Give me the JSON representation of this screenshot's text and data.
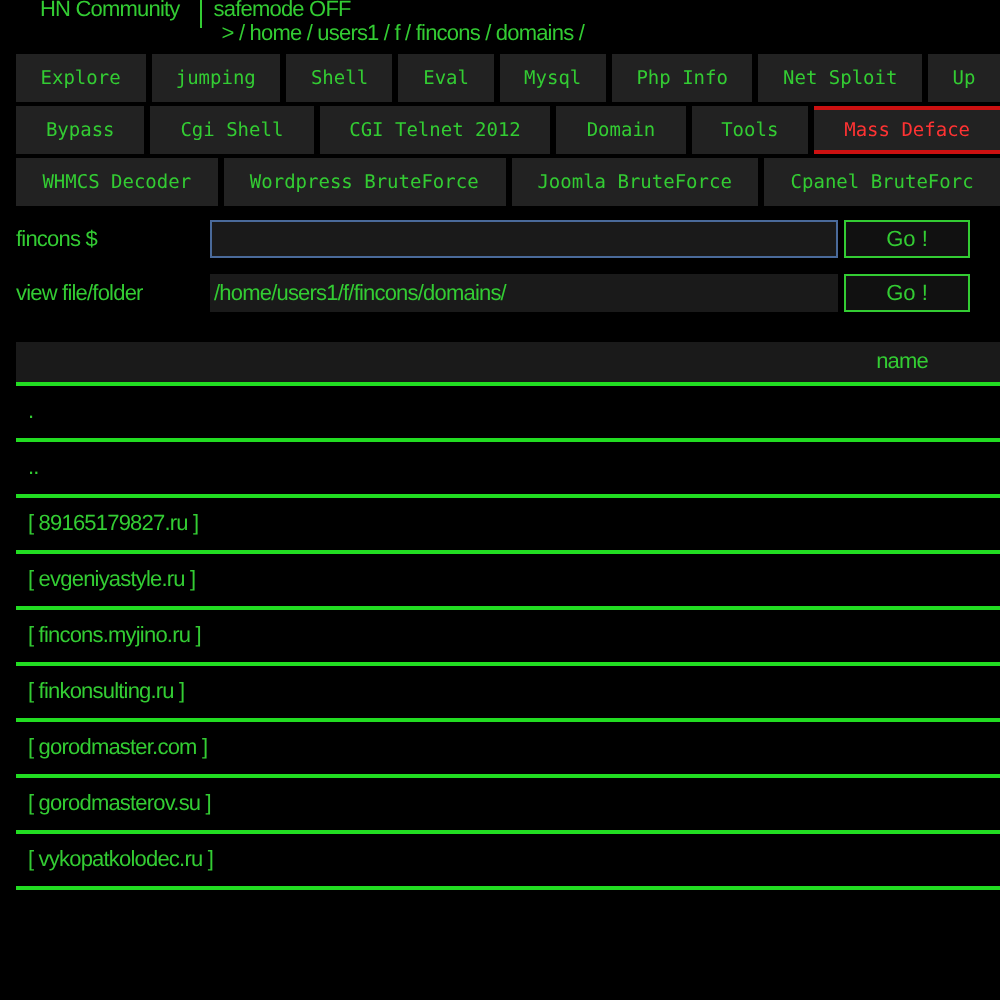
{
  "header": {
    "site": "HN Community",
    "safemode": "safemode OFF",
    "path": "> / home / users1 / f / fincons / domains /"
  },
  "tab_rows": [
    [
      {
        "label": "Explore",
        "selected": false
      },
      {
        "label": "jumping",
        "selected": false
      },
      {
        "label": "Shell",
        "selected": false
      },
      {
        "label": "Eval",
        "selected": false
      },
      {
        "label": "Mysql",
        "selected": false
      },
      {
        "label": "Php Info",
        "selected": false
      },
      {
        "label": "Net Sploit",
        "selected": false
      },
      {
        "label": "Up",
        "selected": false
      }
    ],
    [
      {
        "label": "Bypass",
        "selected": false
      },
      {
        "label": "Cgi Shell",
        "selected": false
      },
      {
        "label": "CGI Telnet 2012",
        "selected": false
      },
      {
        "label": "Domain",
        "selected": false
      },
      {
        "label": "Tools",
        "selected": false
      },
      {
        "label": "Mass Deface",
        "selected": true
      }
    ],
    [
      {
        "label": "WHMCS Decoder",
        "selected": false
      },
      {
        "label": "Wordpress BruteForce",
        "selected": false
      },
      {
        "label": "Joomla BruteForce",
        "selected": false
      },
      {
        "label": "Cpanel BruteForc",
        "selected": false
      }
    ]
  ],
  "forms": [
    {
      "label": "fincons $",
      "focused": true,
      "button": "Go !"
    },
    {
      "label": "view file/folder",
      "value": "/home/users1/f/fincons/domains/",
      "focused": false,
      "button": "Go !"
    }
  ],
  "table": {
    "columns": [
      "name"
    ],
    "rows": [
      ".",
      "..",
      "[ 89165179827.ru ]",
      "[ evgeniyastyle.ru ]",
      "[ fincons.myjino.ru ]",
      "[ finkonsulting.ru ]",
      "[ gorodmaster.com ]",
      "[ gorodmasterov.su ]",
      "[ vykopatkolodec.ru ]"
    ]
  }
}
